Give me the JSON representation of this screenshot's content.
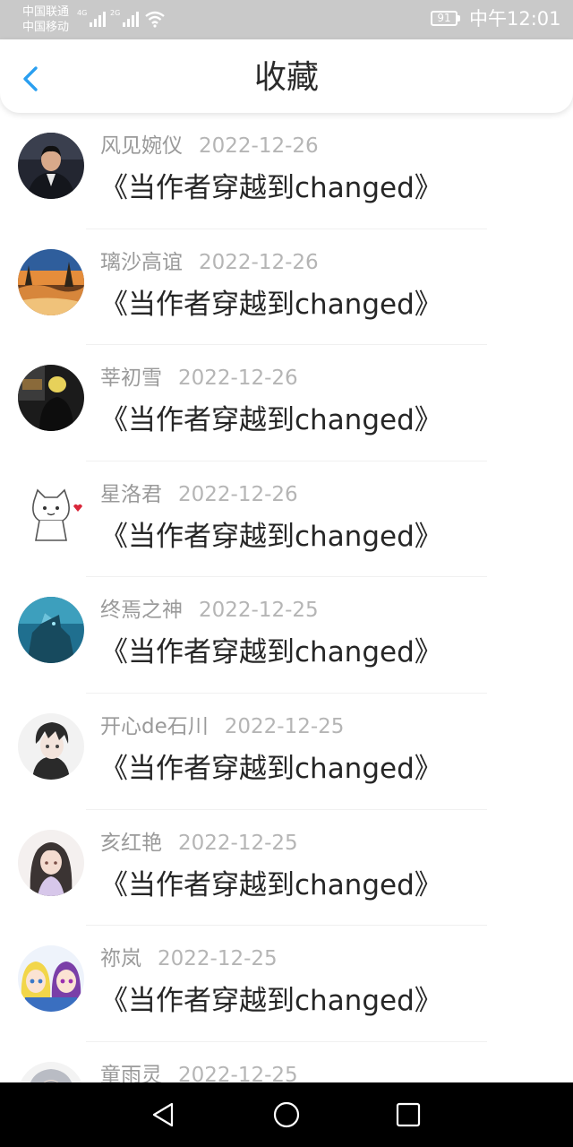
{
  "status_bar": {
    "carrier_1": "中国联通",
    "carrier_2": "中国移动",
    "net_1": "4G",
    "net_2": "2G",
    "battery": "91",
    "time": "中午12:01"
  },
  "header": {
    "title": "收藏"
  },
  "colors": {
    "accent": "#2a9ff0",
    "status_bar": "#c9c9c9",
    "nav_bar": "#000000"
  },
  "favorites": [
    {
      "user": "风见婉仪",
      "date": "2022-12-26",
      "title": "《当作者穿越到changed》",
      "avatar": "man-suit"
    },
    {
      "user": "璃沙高谊",
      "date": "2022-12-26",
      "title": "《当作者穿越到changed》",
      "avatar": "sunset-landscape"
    },
    {
      "user": "莘初雪",
      "date": "2022-12-26",
      "title": "《当作者穿越到changed》",
      "avatar": "dark-figure"
    },
    {
      "user": "星洛君",
      "date": "2022-12-26",
      "title": "《当作者穿越到changed》",
      "avatar": "cartoon-cat"
    },
    {
      "user": "终焉之神",
      "date": "2022-12-25",
      "title": "《当作者穿越到changed》",
      "avatar": "blue-monster"
    },
    {
      "user": "开心de石川",
      "date": "2022-12-25",
      "title": "《当作者穿越到changed》",
      "avatar": "anime-boy"
    },
    {
      "user": "亥红艳",
      "date": "2022-12-25",
      "title": "《当作者穿越到changed》",
      "avatar": "anime-long-hair"
    },
    {
      "user": "祢岚",
      "date": "2022-12-25",
      "title": "《当作者穿越到changed》",
      "avatar": "anime-duo"
    },
    {
      "user": "童雨灵",
      "date": "2022-12-25",
      "title": "",
      "avatar": "anime-grey-hair"
    }
  ]
}
